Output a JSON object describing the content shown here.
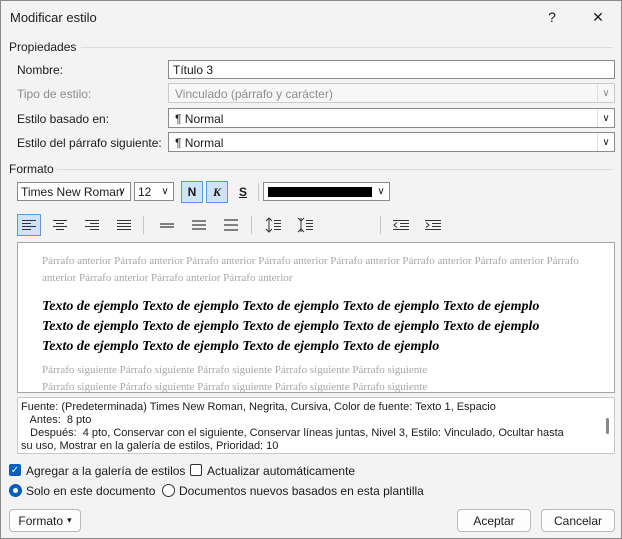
{
  "window": {
    "title": "Modificar estilo",
    "help": "?",
    "close": "✕"
  },
  "properties": {
    "group_label": "Propiedades",
    "name_label": "Nombre:",
    "name_value": "Título 3",
    "type_label": "Tipo de estilo:",
    "type_value": "Vinculado (párrafo y carácter)",
    "based_label": "Estilo basado en:",
    "based_value": "¶  Normal",
    "next_label": "Estilo del párrafo siguiente:",
    "next_value": "¶  Normal"
  },
  "format": {
    "group_label": "Formato",
    "font": "Times New Roman",
    "size": "12",
    "bold": "N",
    "italic": "K",
    "underline": "S",
    "color": "#000000"
  },
  "preview": {
    "previous_text": "Párrafo anterior Párrafo anterior Párrafo anterior Párrafo anterior Párrafo anterior Párrafo anterior Párrafo anterior Párrafo anterior Párrafo anterior Párrafo anterior Párrafo anterior",
    "sample_line1": "Texto de ejemplo Texto de ejemplo Texto de ejemplo Texto de ejemplo Texto de ejemplo",
    "sample_line2": "Texto de ejemplo Texto de ejemplo Texto de ejemplo Texto de ejemplo Texto de ejemplo",
    "sample_line3": "Texto de ejemplo Texto de ejemplo Texto de ejemplo Texto de ejemplo",
    "next_line1": "Párrafo siguiente Párrafo siguiente Párrafo siguiente Párrafo siguiente Párrafo siguiente",
    "next_line2": "Párrafo siguiente Párrafo siguiente Párrafo siguiente Párrafo siguiente Párrafo siguiente"
  },
  "description": {
    "line1": "Fuente: (Predeterminada) Times New Roman, Negrita, Cursiva, Color de fuente: Texto 1, Espacio",
    "line2": "   Antes:  8 pto",
    "line3": "   Después:  4 pto, Conservar con el siguiente, Conservar líneas juntas, Nivel 3, Estilo: Vinculado, Ocultar hasta",
    "line4": "su uso, Mostrar en la galería de estilos, Prioridad: 10"
  },
  "options": {
    "add_gallery": "Agregar a la galería de estilos",
    "auto_update": "Actualizar automáticamente",
    "only_doc": "Solo en este documento",
    "new_docs": "Documentos nuevos basados en esta plantilla"
  },
  "buttons": {
    "format": "Formato",
    "format_arrow": "▾",
    "ok": "Aceptar",
    "cancel": "Cancelar"
  }
}
